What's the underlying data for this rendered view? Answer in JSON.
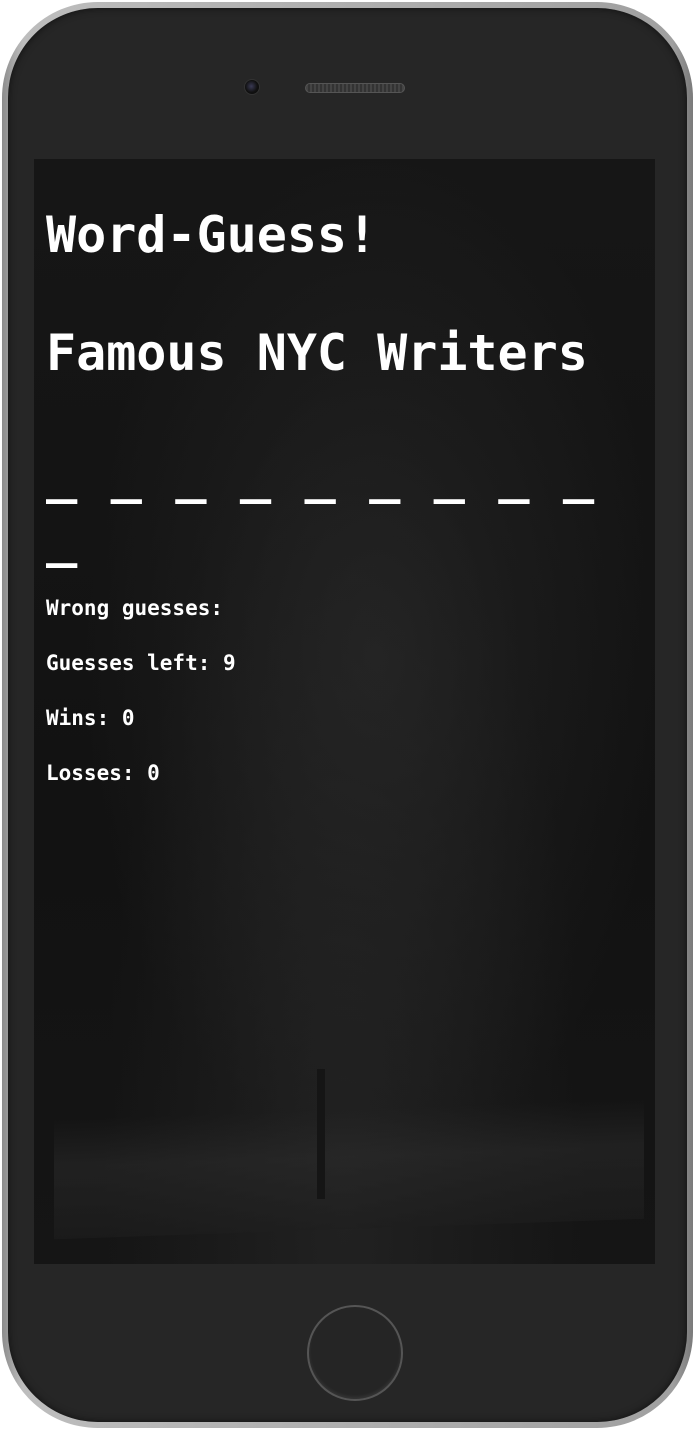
{
  "game": {
    "title": "Word-Guess!",
    "category": "Famous NYC Writers",
    "blanks": "_ _ _ _ _ _ _ _ _ _"
  },
  "stats": {
    "wrong_guesses": "Wrong guesses:",
    "guesses_left": "Guesses left: 9",
    "wins": "Wins: 0",
    "losses": "Losses: 0"
  },
  "device": {
    "frame_color": "#262626",
    "screen_text_color": "#ffffff"
  }
}
